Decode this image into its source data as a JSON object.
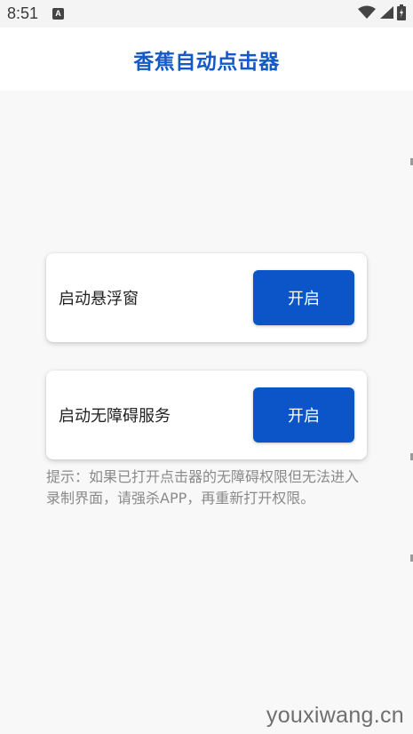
{
  "status_bar": {
    "time": "8:51",
    "app_icon_letter": "A",
    "icons": [
      "wifi-icon",
      "signal-icon",
      "battery-icon"
    ]
  },
  "header": {
    "title": "香蕉自动点击器"
  },
  "cards": [
    {
      "label": "启动悬浮窗",
      "button_label": "开启"
    },
    {
      "label": "启动无障碍服务",
      "button_label": "开启"
    }
  ],
  "hint": "提示：如果已打开点击器的无障碍权限但无法进入录制界面，请强杀APP，再重新打开权限。",
  "watermark": "youxiwang.cn",
  "colors": {
    "accent": "#0c55c8",
    "title": "#1559c4",
    "hint_text": "#8a8a8a",
    "background": "#f8f8f8"
  }
}
